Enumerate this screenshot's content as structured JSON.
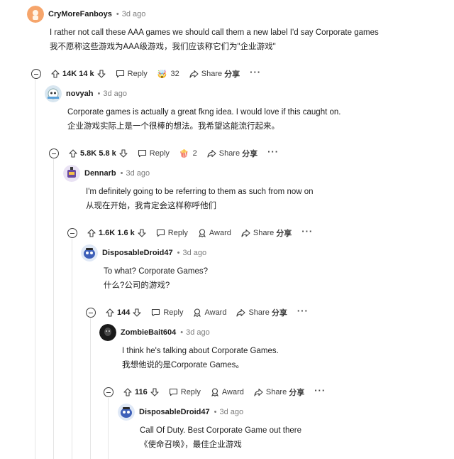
{
  "comments": [
    {
      "author": "CryMoreFanboys",
      "time": "3d ago",
      "line1": "I rather not call these AAA games we should call them a new label I'd say Corporate games",
      "line2": "我不愿称这些游戏为AAA级游戏，我们应该称它们为\"企业游戏\"",
      "votes": "14K",
      "votes_translated": "14 k",
      "award_count": "32",
      "award_icon": "awards-emoji-icon",
      "reply": "Reply",
      "share": "Share",
      "share_translated": "分享"
    },
    {
      "author": "novyah",
      "time": "3d ago",
      "line1": "Corporate games is actually a great fkng idea. I would love if this caught on.",
      "line2": "企业游戏实际上是一个很棒的想法。我希望这能流行起来。",
      "votes": "5.8K",
      "votes_translated": "5.8 k",
      "award_count": "2",
      "award_icon": "popcorn-award-icon",
      "reply": "Reply",
      "share": "Share",
      "share_translated": "分享"
    },
    {
      "author": "Dennarb",
      "time": "3d ago",
      "line1": "I'm definitely going to be referring to them as such from now on",
      "line2": "从现在开始，我肯定会这样称呼他们",
      "votes": "1.6K",
      "votes_translated": "1.6 k",
      "award": "Award",
      "reply": "Reply",
      "share": "Share",
      "share_translated": "分享"
    },
    {
      "author": "DisposableDroid47",
      "time": "3d ago",
      "line1": "To what? Corporate Games?",
      "line2": "什么?公司的游戏?",
      "votes": "144",
      "award": "Award",
      "reply": "Reply",
      "share": "Share",
      "share_translated": "分享"
    },
    {
      "author": "ZombieBait604",
      "time": "3d ago",
      "line1": "I think he's talking about Corporate Games.",
      "line2": "我想他说的是Corporate Games。",
      "votes": "116",
      "award": "Award",
      "reply": "Reply",
      "share": "Share",
      "share_translated": "分享"
    },
    {
      "author": "DisposableDroid47",
      "time": "3d ago",
      "line1": "Call Of Duty. Best Corporate Game out there",
      "line2": "《使命召唤》，最佳企业游戏"
    }
  ],
  "separator": "•",
  "colors": {
    "text": "#1c1c1c",
    "meta": "#7c7c7c",
    "thread_line": "#e5e5e5"
  }
}
